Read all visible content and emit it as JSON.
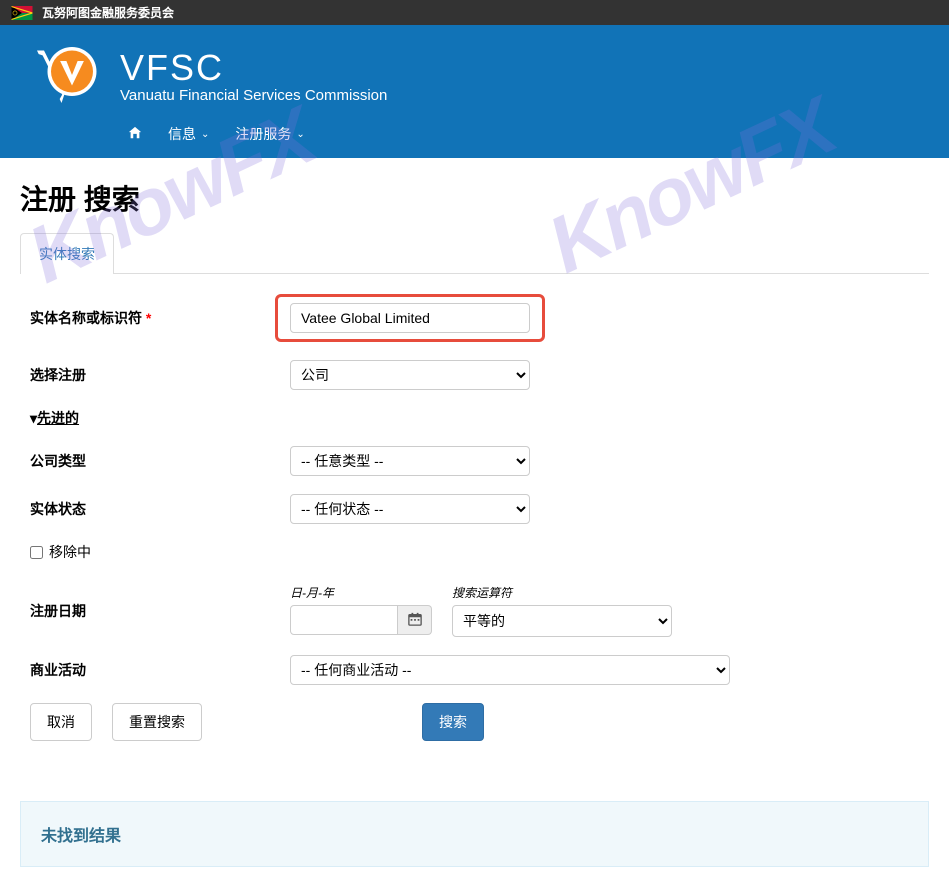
{
  "topbar": {
    "org_name": "瓦努阿图金融服务委员会"
  },
  "header": {
    "title": "VFSC",
    "subtitle": "Vanuatu Financial Services Commission"
  },
  "nav": {
    "info": "信息",
    "register_services": "注册服务"
  },
  "page": {
    "title": "注册 搜索",
    "tab": "实体搜索"
  },
  "form": {
    "entity_name_label": "实体名称或标识符",
    "entity_name_value": "Vatee Global Limited",
    "select_reg_label": "选择注册",
    "select_reg_value": "公司",
    "advanced_label": "先进的",
    "company_type_label": "公司类型",
    "company_type_value": "-- 任意类型 --",
    "entity_status_label": "实体状态",
    "entity_status_value": "-- 任何状态 --",
    "removing_label": "移除中",
    "reg_date_label": "注册日期",
    "date_format_label": "日-月-年",
    "operator_label": "搜索运算符",
    "operator_value": "平等的",
    "business_activity_label": "商业活动",
    "business_activity_value": "-- 任何商业活动 --",
    "cancel_btn": "取消",
    "reset_btn": "重置搜索",
    "search_btn": "搜索"
  },
  "results": {
    "no_results": "未找到结果"
  },
  "watermark": "KnowFX"
}
